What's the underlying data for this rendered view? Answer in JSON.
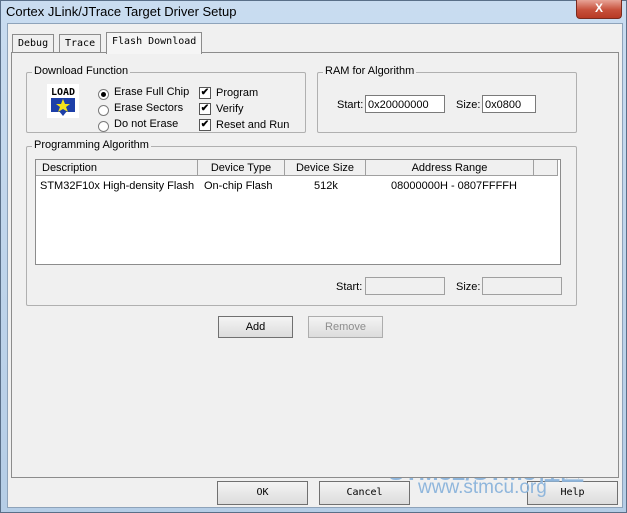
{
  "window": {
    "title": "Cortex JLink/JTrace Target Driver Setup",
    "close_glyph": "X"
  },
  "tabs": [
    {
      "label": "Debug"
    },
    {
      "label": "Trace"
    },
    {
      "label": "Flash Download"
    }
  ],
  "download_function": {
    "group_label": "Download Function",
    "icon_text": "LOAD",
    "erase_options": [
      {
        "label": "Erase Full Chip",
        "selected": true
      },
      {
        "label": "Erase Sectors",
        "selected": false
      },
      {
        "label": "Do not Erase",
        "selected": false
      }
    ],
    "checks": [
      {
        "label": "Program",
        "checked": true
      },
      {
        "label": "Verify",
        "checked": true
      },
      {
        "label": "Reset and Run",
        "checked": true
      }
    ]
  },
  "ram": {
    "group_label": "RAM for Algorithm",
    "start_label": "Start:",
    "start_value": "0x20000000",
    "size_label": "Size:",
    "size_value": "0x0800"
  },
  "programming_algorithm": {
    "group_label": "Programming Algorithm",
    "columns": [
      "Description",
      "Device Type",
      "Device Size",
      "Address Range"
    ],
    "rows": [
      {
        "description": "STM32F10x High-density Flash",
        "device_type": "On-chip Flash",
        "device_size": "512k",
        "address_range": "08000000H - 0807FFFFH"
      }
    ],
    "start_label": "Start:",
    "start_value": "",
    "size_label": "Size:",
    "size_value": ""
  },
  "buttons": {
    "add": "Add",
    "remove": "Remove",
    "ok": "OK",
    "cancel": "Cancel",
    "help": "Help"
  },
  "watermark": {
    "line1": "STM32/STM8社区",
    "line2": "www.stmcu.org"
  }
}
